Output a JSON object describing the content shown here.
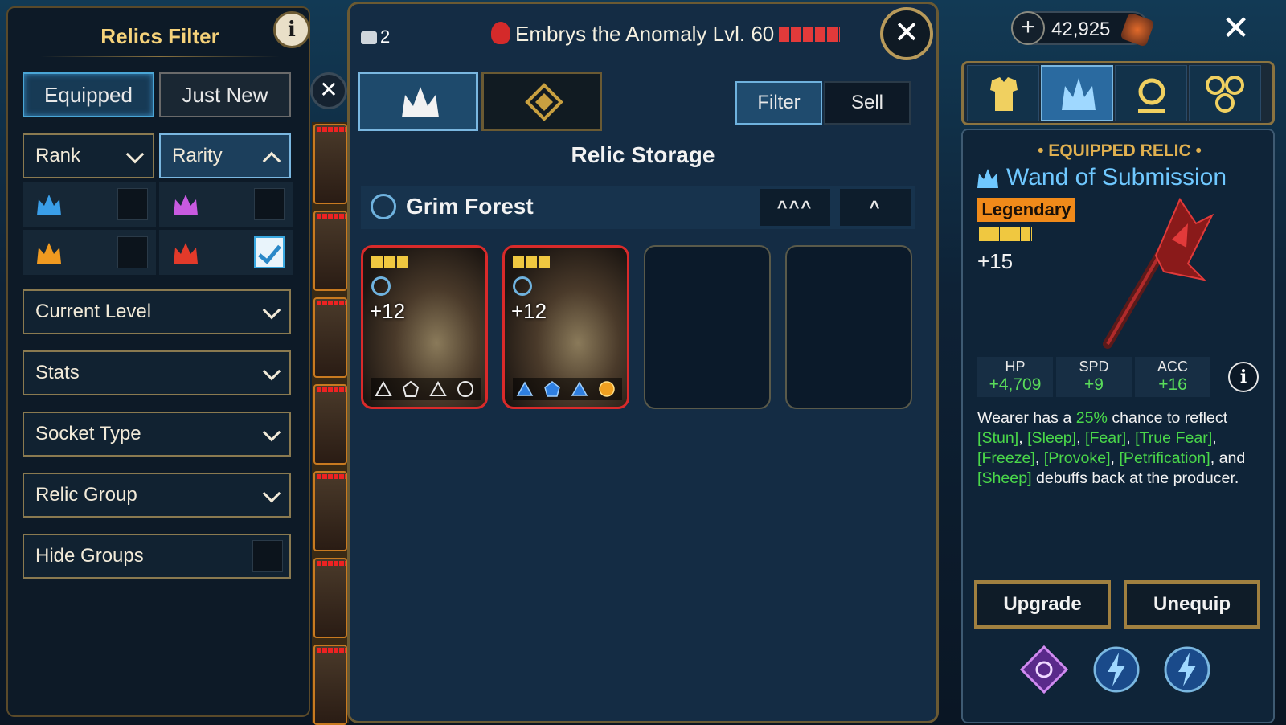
{
  "filter": {
    "title": "Relics Filter",
    "info": "i",
    "tabs": [
      "Equipped",
      "Just New"
    ],
    "active_tab": "Equipped",
    "rank_label": "Rank",
    "rarity_label": "Rarity",
    "rarities": [
      {
        "icon": "crown-blue-icon",
        "color": "#3a9ee8",
        "checked": false
      },
      {
        "icon": "crown-purple-icon",
        "color": "#c85ae0",
        "checked": false
      },
      {
        "icon": "crown-orange-icon",
        "color": "#f09a20",
        "checked": false
      },
      {
        "icon": "crown-red-icon",
        "color": "#e23a2a",
        "checked": true
      }
    ],
    "dropdowns": [
      "Current Level",
      "Stats",
      "Socket Type",
      "Relic Group"
    ],
    "hide_groups": "Hide Groups"
  },
  "storage": {
    "count": "2",
    "hero_name": "Embrys the Anomaly Lvl. 60",
    "filter_btn": "Filter",
    "sell_btn": "Sell",
    "title": "Relic Storage",
    "group": "Grim Forest",
    "sort_all": "^^^",
    "sort_one": "^",
    "relics": [
      {
        "level": "+12",
        "sockets": [
          "empty",
          "empty",
          "empty",
          "empty"
        ]
      },
      {
        "level": "+12",
        "sockets": [
          "blue",
          "blue",
          "blue",
          "gold"
        ]
      }
    ]
  },
  "currency": {
    "value": "42,925",
    "plus": "+"
  },
  "top_close": "✕",
  "detail": {
    "label": "• EQUIPPED RELIC •",
    "name": "Wand of Submission",
    "rarity": "Legendary",
    "level": "+15",
    "stats": [
      {
        "name": "HP",
        "value": "+4,709"
      },
      {
        "name": "SPD",
        "value": "+9"
      },
      {
        "name": "ACC",
        "value": "+16"
      }
    ],
    "info": "i",
    "desc_1": "Wearer has a ",
    "desc_chance": "25%",
    "desc_2": " chance to reflect",
    "desc_debuffs_a": "[Stun]",
    "desc_debuffs_b": "[Sleep]",
    "desc_debuffs_c": "[Fear]",
    "desc_debuffs_d": "[True Fear]",
    "desc_debuffs_e": "[Freeze]",
    "desc_debuffs_f": "[Provoke]",
    "desc_debuffs_g": "[Petrification]",
    "desc_and": "and ",
    "desc_debuffs_h": "[Sheep]",
    "desc_end": " debuffs back at the producer.",
    "upgrade": "Upgrade",
    "unequip": "Unequip"
  }
}
